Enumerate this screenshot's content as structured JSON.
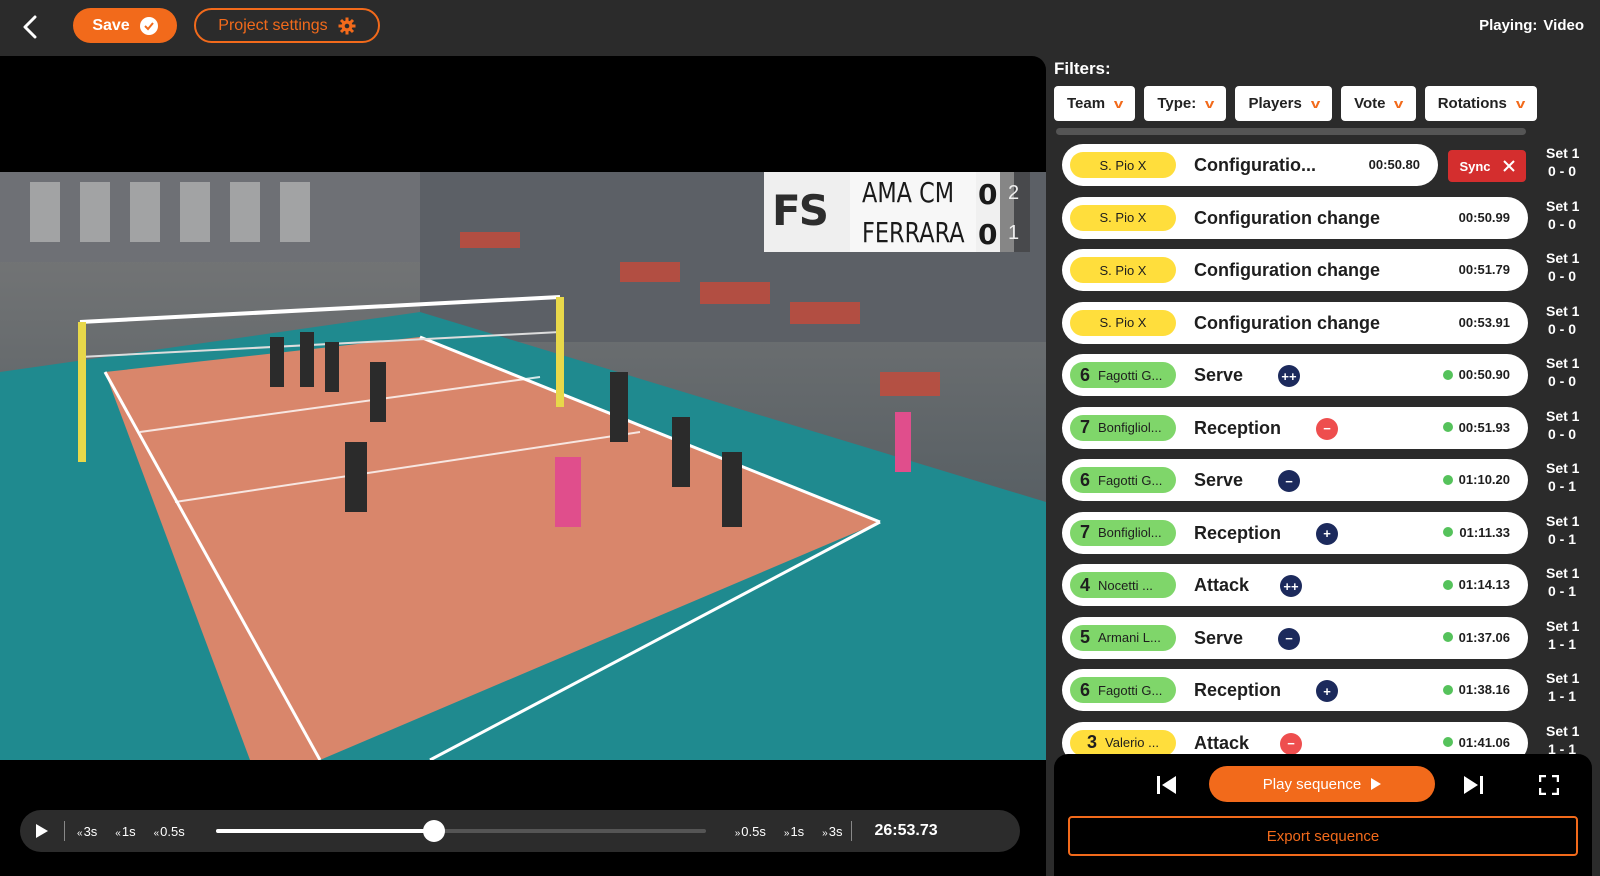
{
  "toolbar": {
    "save_label": "Save",
    "project_settings_label": "Project settings",
    "playing_label": "Playing:",
    "playing_value": "Video"
  },
  "scoreboard": {
    "logo_text": "FS",
    "team1": "AMA CM",
    "team2": "FERRARA",
    "team1_points": "0",
    "team2_points": "0",
    "team1_sets": "2",
    "team2_sets": "1"
  },
  "player": {
    "skip_back": [
      "3s",
      "1s",
      "0.5s"
    ],
    "skip_forward": [
      "0.5s",
      "1s",
      "3s"
    ],
    "progress": 0.445,
    "timecode": "26:53.73"
  },
  "filters": {
    "title": "Filters:",
    "buttons": [
      {
        "label": "Team"
      },
      {
        "label": "Type:"
      },
      {
        "label": "Players"
      },
      {
        "label": "Vote"
      },
      {
        "label": "Rotations"
      }
    ]
  },
  "events": [
    {
      "tag": "S. Pio X",
      "tag_color": "yellow",
      "number": "",
      "action": "Configuratio...",
      "time": "00:50.80",
      "badge": "",
      "dot": false,
      "sync": "Sync",
      "set": "Set 1",
      "score": "0 - 0"
    },
    {
      "tag": "S. Pio X",
      "tag_color": "yellow",
      "number": "",
      "action": "Configuration change",
      "time": "00:50.99",
      "badge": "",
      "dot": false,
      "sync": "",
      "set": "Set 1",
      "score": "0 - 0"
    },
    {
      "tag": "S. Pio X",
      "tag_color": "yellow",
      "number": "",
      "action": "Configuration change",
      "time": "00:51.79",
      "badge": "",
      "dot": false,
      "sync": "",
      "set": "Set 1",
      "score": "0 - 0"
    },
    {
      "tag": "S. Pio X",
      "tag_color": "yellow",
      "number": "",
      "action": "Configuration change",
      "time": "00:53.91",
      "badge": "",
      "dot": false,
      "sync": "",
      "set": "Set 1",
      "score": "0 - 0"
    },
    {
      "tag": "Fagotti G...",
      "tag_color": "green",
      "number": "6",
      "action": "Serve",
      "time": "00:50.90",
      "badge": "++",
      "badge_color": "navy",
      "dot": true,
      "sync": "",
      "set": "Set 1",
      "score": "0 - 0"
    },
    {
      "tag": "Bonfigliol...",
      "tag_color": "green",
      "number": "7",
      "action": "Reception",
      "time": "00:51.93",
      "badge": "−",
      "badge_color": "red",
      "dot": true,
      "sync": "",
      "set": "Set 1",
      "score": "0 - 0"
    },
    {
      "tag": "Fagotti G...",
      "tag_color": "green",
      "number": "6",
      "action": "Serve",
      "time": "01:10.20",
      "badge": "−",
      "badge_color": "navy",
      "dot": true,
      "sync": "",
      "set": "Set 1",
      "score": "0 - 1"
    },
    {
      "tag": "Bonfigliol...",
      "tag_color": "green",
      "number": "7",
      "action": "Reception",
      "time": "01:11.33",
      "badge": "+",
      "badge_color": "navy",
      "dot": true,
      "sync": "",
      "set": "Set 1",
      "score": "0 - 1"
    },
    {
      "tag": "Nocetti ...",
      "tag_color": "green",
      "number": "4",
      "action": "Attack",
      "time": "01:14.13",
      "badge": "++",
      "badge_color": "navy",
      "dot": true,
      "sync": "",
      "set": "Set 1",
      "score": "0 - 1"
    },
    {
      "tag": "Armani L...",
      "tag_color": "green",
      "number": "5",
      "action": "Serve",
      "time": "01:37.06",
      "badge": "−",
      "badge_color": "navy",
      "dot": true,
      "sync": "",
      "set": "Set 1",
      "score": "1 - 1"
    },
    {
      "tag": "Fagotti G...",
      "tag_color": "green",
      "number": "6",
      "action": "Reception",
      "time": "01:38.16",
      "badge": "+",
      "badge_color": "navy",
      "dot": true,
      "sync": "",
      "set": "Set 1",
      "score": "1 - 1"
    },
    {
      "tag": "Valerio ...",
      "tag_color": "yellow",
      "number": "3",
      "action": "Attack",
      "time": "01:41.06",
      "badge": "−",
      "badge_color": "red",
      "dot": true,
      "sync": "",
      "set": "Set 1",
      "score": "1 - 1"
    }
  ],
  "sequence": {
    "play_label": "Play sequence",
    "export_label": "Export sequence"
  },
  "colors": {
    "accent": "#f26a1b",
    "tag_yellow": "#ffde3c",
    "tag_green": "#7fd66a",
    "sync_red": "#d42e2e"
  }
}
